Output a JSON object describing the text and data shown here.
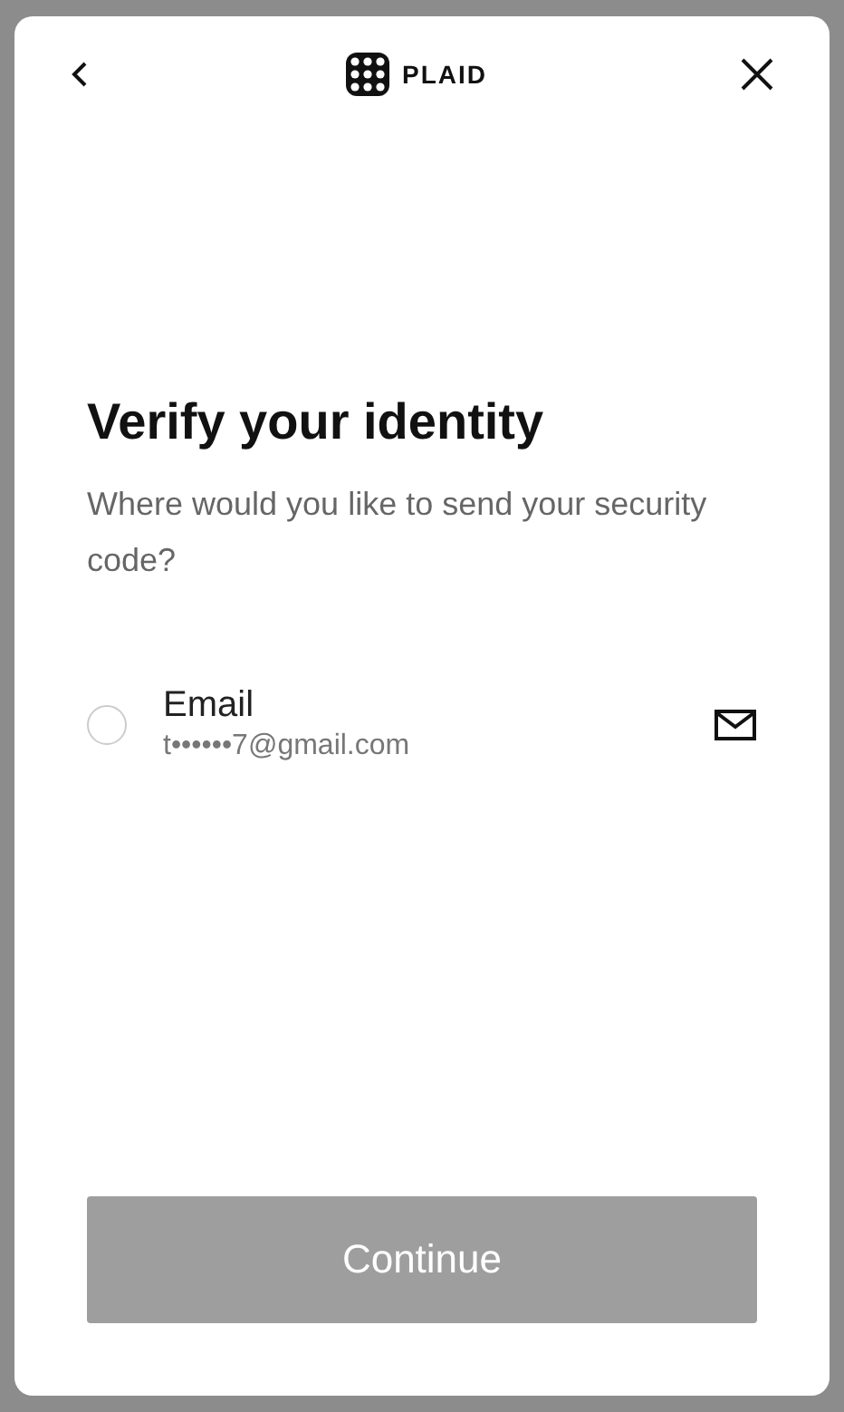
{
  "header": {
    "brand": "PLAID"
  },
  "title": "Verify your identity",
  "subtitle": "Where would you like to send your security code?",
  "options": [
    {
      "kind": "email",
      "label": "Email",
      "detail": "t••••••7@gmail.com",
      "selected": false
    }
  ],
  "button": {
    "label": "Continue",
    "disabled": true
  }
}
